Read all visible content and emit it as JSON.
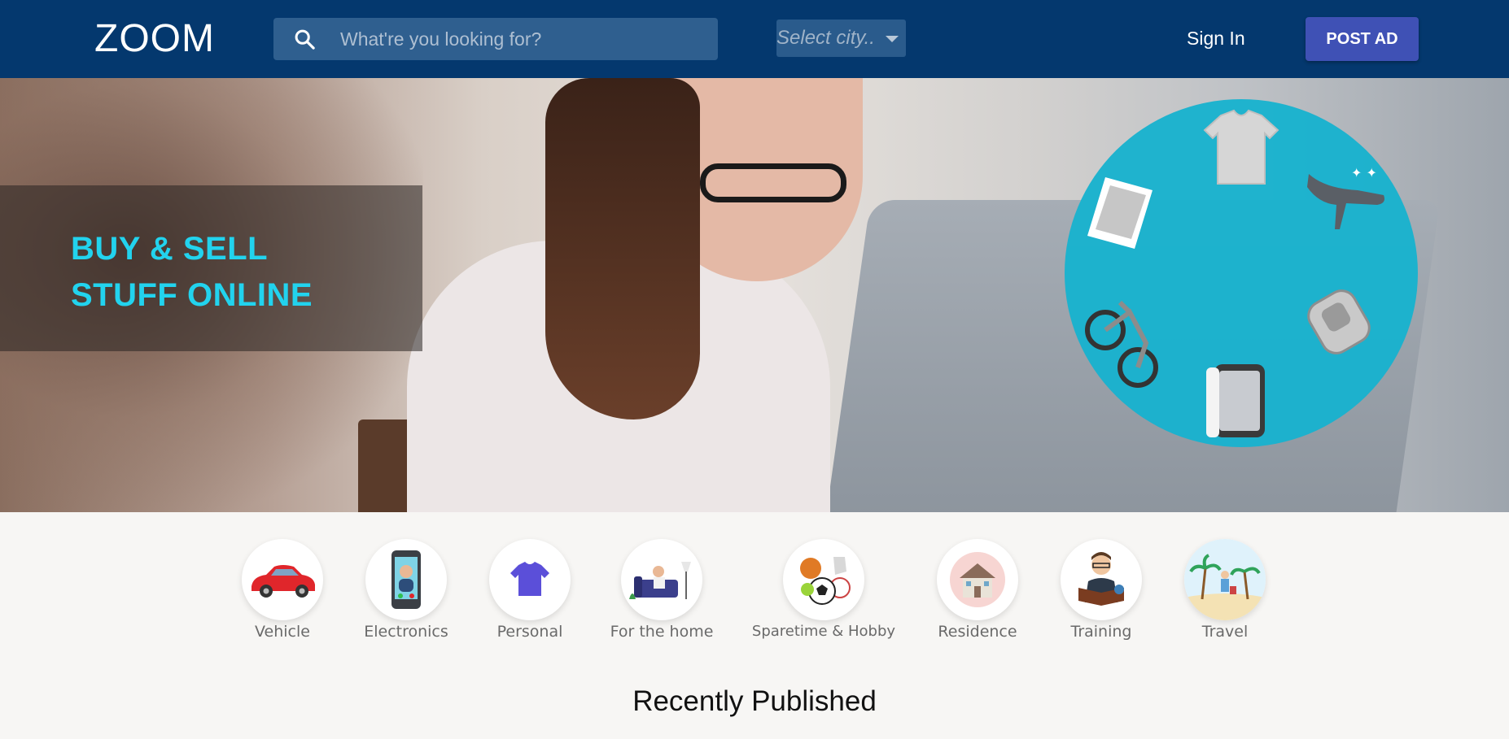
{
  "header": {
    "logo": "ZOOM",
    "search_placeholder": "What're you looking for?",
    "search_icon": "search-icon",
    "city_select": "Select city..",
    "sign_in": "Sign In",
    "post_ad": "POST AD",
    "background_color": "#04386e",
    "post_ad_color": "#3f51b5"
  },
  "hero": {
    "tagline_line1": "BUY & SELL",
    "tagline_line2": "STUFF ONLINE",
    "tagline_color": "#22d3ee",
    "circle_color": "#18b2ce",
    "circle_icons": [
      "t-shirt-icon",
      "high-heel-icon",
      "backpack-icon",
      "smartphone-icon",
      "bicycle-icon",
      "laptop-icon"
    ]
  },
  "categories": [
    {
      "label": "Vehicle",
      "icon": "car-icon"
    },
    {
      "label": "Electronics",
      "icon": "phone-icon"
    },
    {
      "label": "Personal",
      "icon": "t-shirt-icon"
    },
    {
      "label": "For the home",
      "icon": "sofa-icon"
    },
    {
      "label": "Sparetime & Hobby",
      "icon": "sports-balls-icon"
    },
    {
      "label": "Residence",
      "icon": "house-icon"
    },
    {
      "label": "Training",
      "icon": "reading-man-icon"
    },
    {
      "label": "Travel",
      "icon": "beach-icon"
    }
  ],
  "recent": {
    "title": "Recently Published"
  }
}
